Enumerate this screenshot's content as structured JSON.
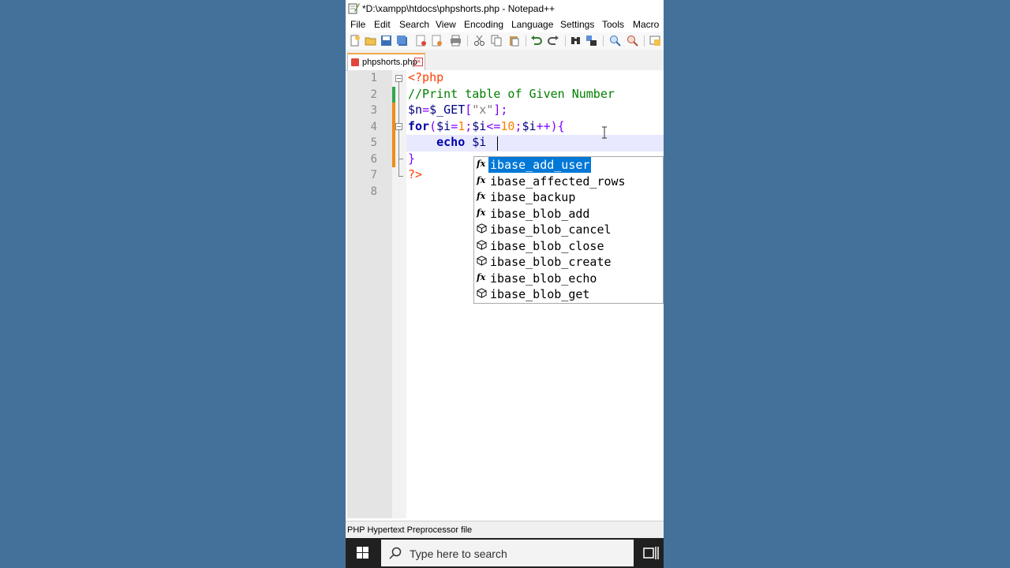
{
  "window": {
    "title": "*D:\\xampp\\htdocs\\phpshorts.php - Notepad++"
  },
  "menu": {
    "items": [
      "File",
      "Edit",
      "Search",
      "View",
      "Encoding",
      "Language",
      "Settings",
      "Tools",
      "Macro"
    ]
  },
  "tab": {
    "label": "phpshorts.php"
  },
  "editor": {
    "line_numbers": [
      "1",
      "2",
      "3",
      "4",
      "5",
      "6",
      "7",
      "8"
    ],
    "lines": [
      [
        {
          "t": "<?php",
          "c": "php"
        }
      ],
      [
        {
          "t": "//Print table of Given Number",
          "c": "com"
        }
      ],
      [
        {
          "t": "$n",
          "c": "var"
        },
        {
          "t": "=",
          "c": "op"
        },
        {
          "t": "$_GET",
          "c": "var"
        },
        {
          "t": "[",
          "c": "op"
        },
        {
          "t": "\"x\"",
          "c": "str"
        },
        {
          "t": "];",
          "c": "op"
        }
      ],
      [
        {
          "t": "for",
          "c": "kw"
        },
        {
          "t": "(",
          "c": "op"
        },
        {
          "t": "$i",
          "c": "var"
        },
        {
          "t": "=",
          "c": "op"
        },
        {
          "t": "1",
          "c": "num"
        },
        {
          "t": ";",
          "c": "op"
        },
        {
          "t": "$i",
          "c": "var"
        },
        {
          "t": "<=",
          "c": "op"
        },
        {
          "t": "10",
          "c": "num"
        },
        {
          "t": ";",
          "c": "op"
        },
        {
          "t": "$i",
          "c": "var"
        },
        {
          "t": "++){",
          "c": "op"
        }
      ],
      [
        {
          "t": "    ",
          "c": "def"
        },
        {
          "t": "echo",
          "c": "kw"
        },
        {
          "t": " ",
          "c": "def"
        },
        {
          "t": "$i",
          "c": "var"
        }
      ],
      [
        {
          "t": "}",
          "c": "op"
        }
      ],
      [
        {
          "t": "?>",
          "c": "php"
        }
      ],
      []
    ]
  },
  "autocomplete": {
    "items": [
      {
        "icon": "function-icon",
        "label": "ibase_add_user",
        "selected": true
      },
      {
        "icon": "function-icon",
        "label": "ibase_affected_rows"
      },
      {
        "icon": "function-icon",
        "label": "ibase_backup"
      },
      {
        "icon": "function-icon",
        "label": "ibase_blob_add"
      },
      {
        "icon": "cube-icon",
        "label": "ibase_blob_cancel"
      },
      {
        "icon": "cube-icon",
        "label": "ibase_blob_close"
      },
      {
        "icon": "cube-icon",
        "label": "ibase_blob_create"
      },
      {
        "icon": "function-icon",
        "label": "ibase_blob_echo"
      },
      {
        "icon": "cube-icon",
        "label": "ibase_blob_get"
      }
    ]
  },
  "statusbar": {
    "text": "PHP Hypertext Preprocessor file"
  },
  "taskbar": {
    "search_placeholder": "Type here to search"
  },
  "colors": {
    "desktop": "#44719a",
    "selection": "#0078d7",
    "tab_accent": "#f4a64a"
  }
}
